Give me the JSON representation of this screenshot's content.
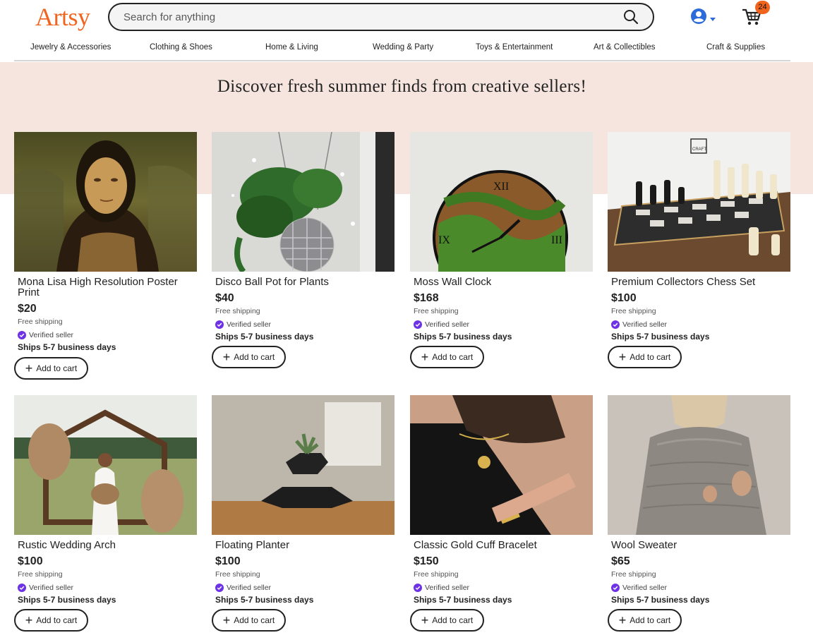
{
  "header": {
    "logo": "Artsy",
    "search_placeholder": "Search for anything",
    "cart_count": "24"
  },
  "nav": {
    "items": [
      "Jewelry & Accessories",
      "Clothing & Shoes",
      "Home & Living",
      "Wedding & Party",
      "Toys & Entertainment",
      "Art & Collectibles",
      "Craft & Supplies"
    ]
  },
  "hero": {
    "title": "Discover fresh summer finds from creative sellers!"
  },
  "labels": {
    "shipping": "Free shipping",
    "verified": "Verified seller",
    "ships": "Ships 5-7 business days",
    "add_to_cart": "Add to cart"
  },
  "colors": {
    "brand": "#F1641E",
    "hero_bg": "#F6E5DE",
    "verified_badge": "#6E32E6"
  },
  "products": [
    {
      "title": "Mona Lisa High Resolution Poster Print",
      "price": "$20",
      "image": "mona-lisa-painting"
    },
    {
      "title": "Disco Ball Pot for Plants",
      "price": "$40",
      "image": "disco-ball-planter"
    },
    {
      "title": "Moss Wall Clock",
      "price": "$168",
      "image": "moss-wall-clock"
    },
    {
      "title": "Premium Collectors Chess Set",
      "price": "$100",
      "image": "chess-set"
    },
    {
      "title": "Rustic Wedding Arch",
      "price": "$100",
      "image": "wedding-arch"
    },
    {
      "title": "Floating Planter",
      "price": "$100",
      "image": "floating-planter"
    },
    {
      "title": "Classic Gold Cuff Bracelet",
      "price": "$150",
      "image": "gold-cuff-bracelet"
    },
    {
      "title": "Wool Sweater",
      "price": "$65",
      "image": "wool-sweater"
    }
  ]
}
